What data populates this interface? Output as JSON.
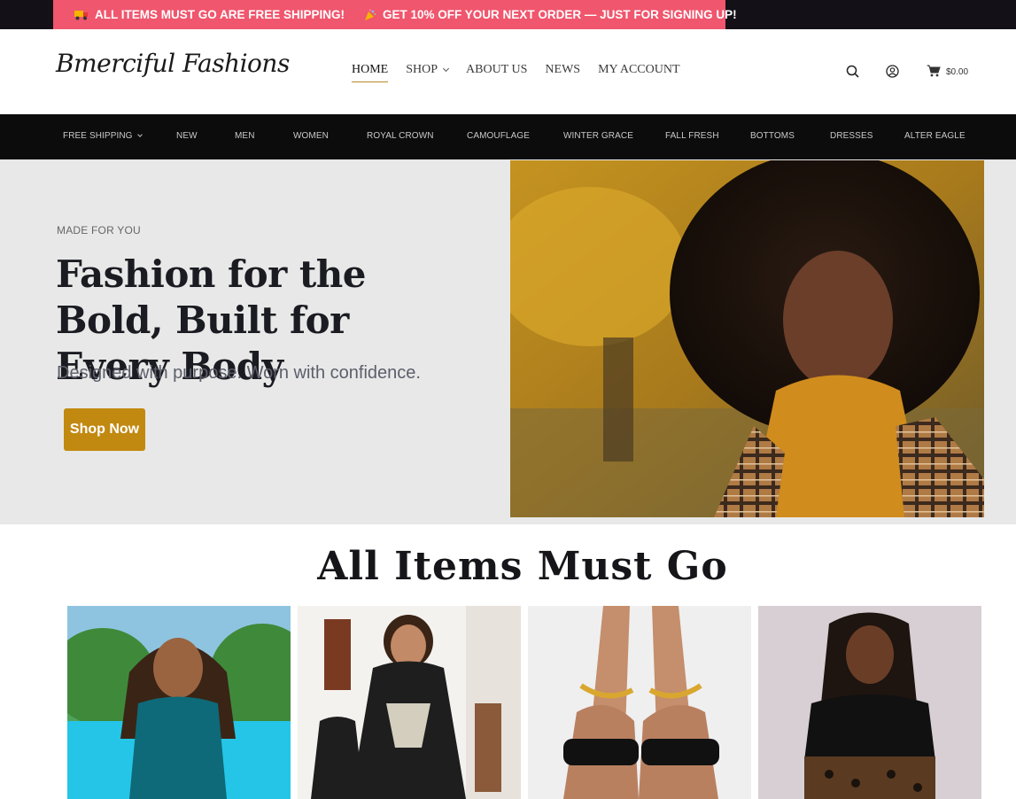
{
  "announcement": {
    "message_1": "ALL ITEMS MUST GO ARE FREE SHIPPING!",
    "message_2": "GET 10% OFF YOUR NEXT ORDER — JUST FOR SIGNING UP!",
    "icon_1": "truck-icon",
    "icon_2": "party-popper-icon"
  },
  "header": {
    "logo": "Bmerciful Fashions",
    "nav": [
      "HOME",
      "SHOP",
      "ABOUT US",
      "NEWS",
      "MY ACCOUNT"
    ],
    "active_nav": "HOME",
    "cart_total": "$0.00"
  },
  "categories": [
    "FREE SHIPPING",
    "NEW",
    "MEN",
    "WOMEN",
    "ROYAL CROWN",
    "CAMOUFLAGE",
    "WINTER GRACE",
    "FALL FRESH",
    "BOTTOMS",
    "DRESSES",
    "ALTER EAGLE"
  ],
  "hero": {
    "eyebrow": "MADE FOR YOU",
    "title": "Fashion for the Bold, Built for Every Body",
    "subtitle": "Designed with purpose. Worn with confidence.",
    "cta": "Shop Now"
  },
  "section": {
    "title": "All Items Must Go"
  },
  "colors": {
    "announcement_bg": "#f0566d",
    "topbar_bg": "#141018",
    "category_bar_bg": "#0c0c0c",
    "hero_bg": "#e8e8e8",
    "accent": "#c28910"
  }
}
